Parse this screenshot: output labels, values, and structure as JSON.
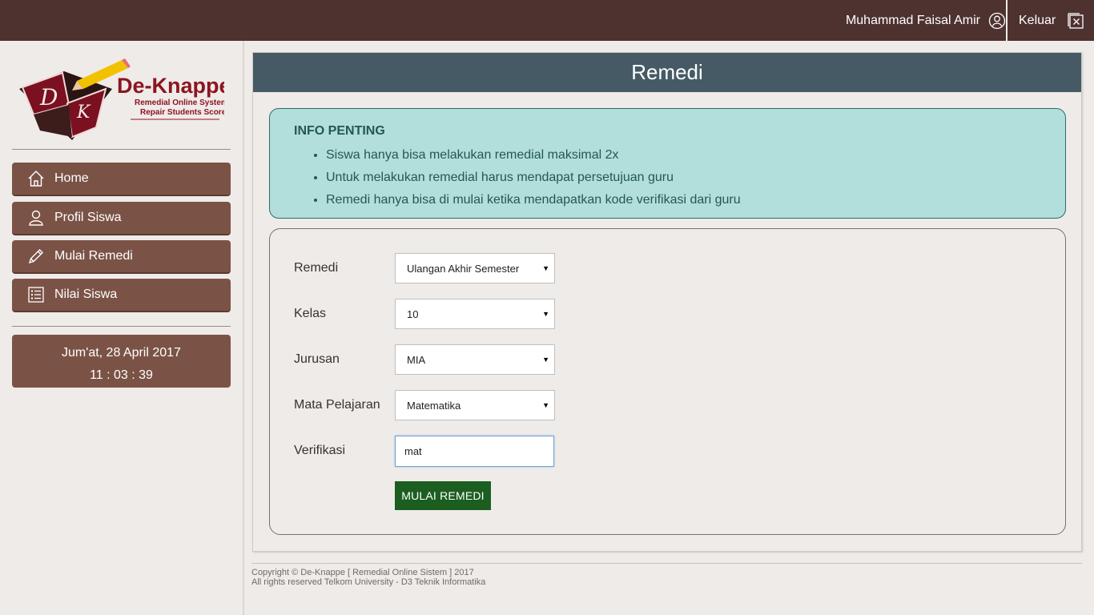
{
  "header": {
    "user_name": "Muhammad Faisal Amir",
    "logout_label": "Keluar"
  },
  "logo": {
    "title": "De-Knappe",
    "subtitle_1": "Remedial Online System",
    "subtitle_2": "Repair Students Score",
    "monogram_1": "D",
    "monogram_2": "K"
  },
  "sidebar": {
    "items": [
      {
        "label": "Home",
        "icon": "home-icon"
      },
      {
        "label": "Profil Siswa",
        "icon": "user-icon"
      },
      {
        "label": "Mulai Remedi",
        "icon": "pencil-icon"
      },
      {
        "label": "Nilai Siswa",
        "icon": "list-icon"
      }
    ],
    "date": "Jum'at, 28 April 2017",
    "time": "11 : 03 : 39"
  },
  "main": {
    "title": "Remedi",
    "info": {
      "title": "INFO PENTING",
      "items": [
        "Siswa hanya bisa melakukan remedial maksimal 2x",
        "Untuk melakukan remedial harus mendapat persetujuan guru",
        "Remedi hanya bisa di mulai ketika mendapatkan kode verifikasi dari guru"
      ]
    },
    "form": {
      "remedi_label": "Remedi",
      "remedi_value": "Ulangan Akhir Semester",
      "kelas_label": "Kelas",
      "kelas_value": "10",
      "jurusan_label": "Jurusan",
      "jurusan_value": "MIA",
      "mapel_label": "Mata Pelajaran",
      "mapel_value": "Matematika",
      "verifikasi_label": "Verifikasi",
      "verifikasi_value": "mat",
      "submit_label": "MULAI REMEDI"
    }
  },
  "footer": {
    "line1": "Copyright © De-Knappe [ Remedial Online Sistem ] 2017",
    "line2": "All rights reserved Telkom University - D3 Teknik Informatika"
  },
  "colors": {
    "topbar": "#4e3230",
    "nav_button": "#7b5346",
    "panel_header": "#455a64",
    "info_bg": "#b2dfdb",
    "submit_button": "#1b5e20"
  }
}
